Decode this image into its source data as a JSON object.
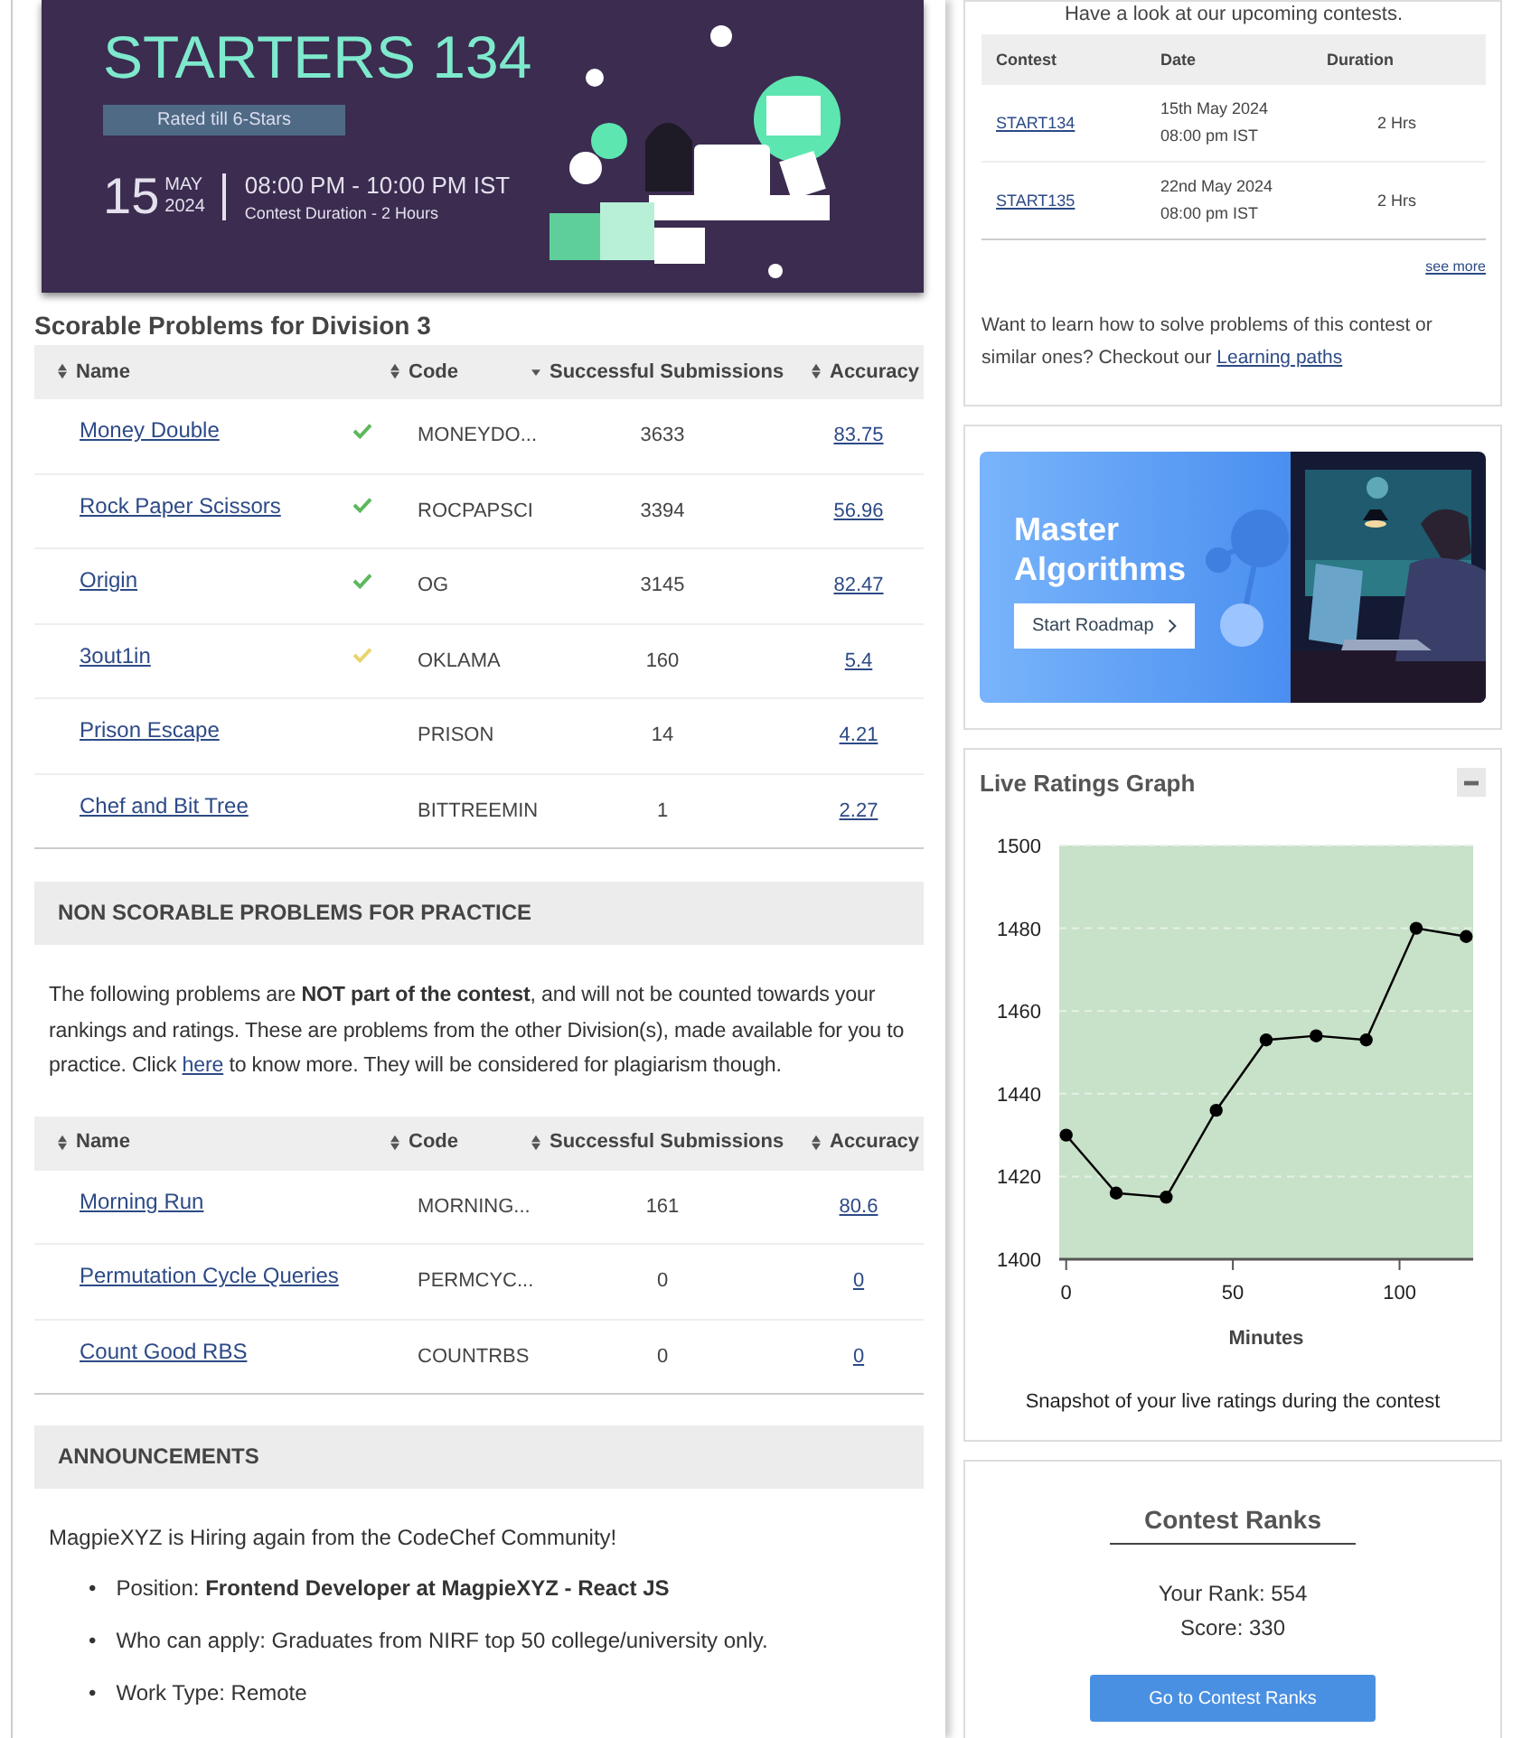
{
  "banner": {
    "title": "STARTERS 134",
    "badge": "Rated till 6-Stars",
    "day": "15",
    "month": "MAY",
    "year": "2024",
    "time": "08:00 PM - 10:00 PM IST",
    "duration": "Contest Duration - 2  Hours"
  },
  "scorable": {
    "title": "Scorable Problems for Division 3",
    "columns": [
      {
        "label": "Name",
        "sorted": false
      },
      {
        "label": "Code",
        "sorted": false
      },
      {
        "label": "Successful Submissions",
        "sorted": true
      },
      {
        "label": "Accuracy",
        "sorted": false
      }
    ],
    "rows": [
      {
        "name": "Money Double",
        "checked": true,
        "color": "#5cb85c",
        "code": "MONEYDO...",
        "submissions": "3633",
        "accuracy": "83.75"
      },
      {
        "name": "Rock Paper Scissors",
        "checked": true,
        "color": "#5cb85c",
        "code": "ROCPAPSCI",
        "submissions": "3394",
        "accuracy": "56.96"
      },
      {
        "name": "Origin",
        "checked": true,
        "color": "#5cb85c",
        "code": "OG",
        "submissions": "3145",
        "accuracy": "82.47"
      },
      {
        "name": "3out1in",
        "checked": true,
        "color": "#e8d56a",
        "code": "OKLAMA",
        "submissions": "160",
        "accuracy": "5.4"
      },
      {
        "name": "Prison Escape",
        "checked": false,
        "code": "PRISON",
        "submissions": "14",
        "accuracy": "4.21"
      },
      {
        "name": "Chef and Bit Tree",
        "checked": false,
        "code": "BITTREEMIN",
        "submissions": "1",
        "accuracy": "2.27"
      }
    ]
  },
  "practice": {
    "title": "NON SCORABLE PROBLEMS FOR PRACTICE",
    "notice_before": "The following problems are **NOT part of the contest**, and will not be counted towards your rankings and ratings. These are problems from the other Division(s), made available for you to practice. Click ",
    "notice_link": "here",
    "notice_after": " to know more. They will be considered for plagiarism though.",
    "columns": [
      {
        "label": "Name",
        "sorted": false
      },
      {
        "label": "Code",
        "sorted": false
      },
      {
        "label": "Successful Submissions",
        "sorted": false
      },
      {
        "label": "Accuracy",
        "sorted": false
      }
    ],
    "rows": [
      {
        "name": "Morning Run",
        "checked": false,
        "code": "MORNING...",
        "submissions": "161",
        "accuracy": "80.6"
      },
      {
        "name": "Permutation Cycle Queries",
        "checked": false,
        "code": "PERMCYC...",
        "submissions": "0",
        "accuracy": "0"
      },
      {
        "name": "Count Good RBS",
        "checked": false,
        "code": "COUNTRBS",
        "submissions": "0",
        "accuracy": "0"
      }
    ]
  },
  "announcements": {
    "title": "ANNOUNCEMENTS",
    "intro": "MagpieXYZ is Hiring again from the CodeChef Community!",
    "bullets": [
      {
        "marker": "•",
        "text": "Position: **Frontend Developer at MagpieXYZ - React JS**"
      },
      {
        "marker": "•",
        "text": "Who can apply: Graduates from NIRF top 50 college/university only."
      },
      {
        "marker": "•",
        "text": "Work Type: Remote"
      }
    ]
  },
  "upcoming": {
    "intro": "Have a look at our upcoming contests.",
    "columns": [
      "Contest",
      "Date",
      "Duration"
    ],
    "rows": [
      {
        "contest": "START134",
        "date": "15th May 2024",
        "time": "08:00 pm IST",
        "duration": "2 Hrs"
      },
      {
        "contest": "START135",
        "date": "22nd May 2024",
        "time": "08:00 pm IST",
        "duration": "2 Hrs"
      }
    ],
    "see_more": "see more",
    "learn_text": "Want to learn how to solve problems of this contest or similar ones? Checkout our ",
    "learn_link": "Learning paths"
  },
  "promo": {
    "title": "Master Algorithms",
    "button": "Start Roadmap"
  },
  "ratings": {
    "title": "Live Ratings Graph",
    "caption": "Snapshot of your live ratings during the contest",
    "chart_data": {
      "type": "line",
      "xlabel": "Minutes",
      "x": [
        0,
        15,
        30,
        45,
        60,
        75,
        90,
        105,
        120
      ],
      "series": [
        {
          "color": "#000000",
          "marker": "circle",
          "values": [
            1430,
            1416,
            1415,
            1436,
            1453,
            1454,
            1453,
            1480,
            1478
          ]
        }
      ],
      "grid": true,
      "xlim": [
        -1,
        121
      ],
      "ylim": [
        1400,
        1500
      ],
      "xticks": [
        0,
        50,
        100
      ],
      "yticks": [
        1400,
        1420,
        1440,
        1460,
        1480,
        1500
      ]
    }
  },
  "ranks": {
    "title": "Contest Ranks",
    "rank": "Your Rank: 554",
    "score": "Score: 330",
    "button": "Go to Contest Ranks"
  }
}
